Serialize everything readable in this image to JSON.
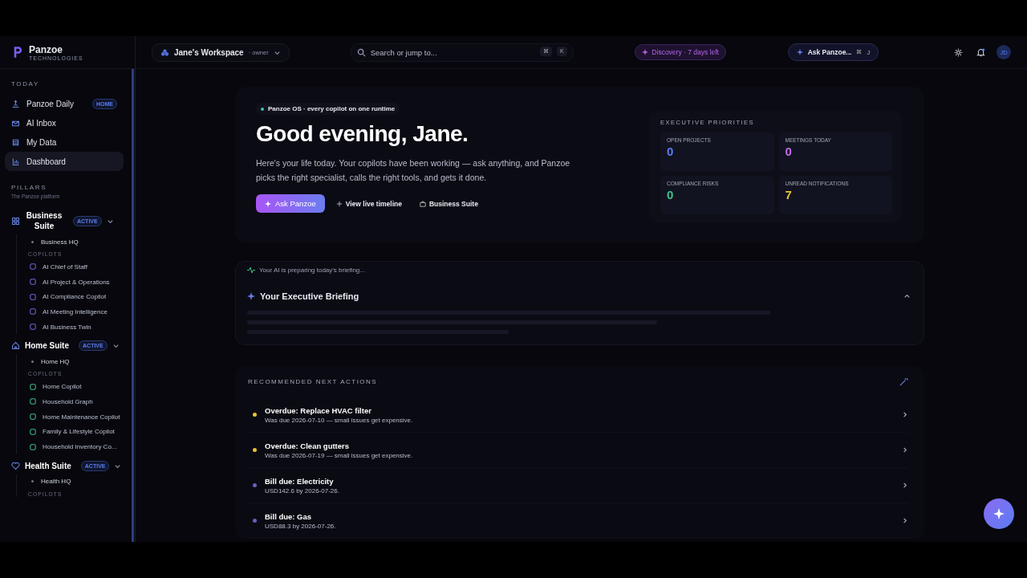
{
  "brand": {
    "name": "Panzoe",
    "tagline": "TECHNOLOGIES"
  },
  "workspace": {
    "name": "Jane's Workspace",
    "role": "· owner"
  },
  "search": {
    "placeholder": "Search or jump to...",
    "keys": [
      "⌘",
      "K"
    ]
  },
  "trial_badge": "Discovery · 7 days left",
  "ask_button": {
    "label": "Ask Panzoe...",
    "keys": [
      "⌘",
      "J"
    ]
  },
  "notifications": {
    "unread": true
  },
  "avatar": "JD",
  "sidebar": {
    "today_heading": "TODAY",
    "today_items": [
      {
        "label": "Panzoe Daily",
        "badge": "HOME",
        "selected": false
      },
      {
        "label": "AI Inbox",
        "selected": false
      },
      {
        "label": "My Data",
        "selected": false
      },
      {
        "label": "Dashboard",
        "selected": true
      }
    ],
    "pillars_heading": "PILLARS",
    "pillars_subtitle": "The Panzoe platform",
    "pillars": [
      {
        "name": "Business Suite",
        "badge": "ACTIVE",
        "expanded": true,
        "hq": "Business HQ",
        "copilots_heading": "COPILOTS",
        "copilots": [
          "AI Chief of Staff",
          "AI Project & Operations",
          "AI Compliance Copilot",
          "AI Meeting Intelligence",
          "AI Business Twin"
        ]
      },
      {
        "name": "Home Suite",
        "badge": "ACTIVE",
        "expanded": true,
        "hq": "Home HQ",
        "copilots_heading": "COPILOTS",
        "copilots": [
          "Home Copilot",
          "Household Graph",
          "Home Maintenance Copilot",
          "Family & Lifestyle Copilot",
          "Household Inventory Co..."
        ]
      },
      {
        "name": "Health Suite",
        "badge": "ACTIVE",
        "expanded": true,
        "hq": "Health HQ",
        "copilots_heading": "COPILOTS"
      }
    ]
  },
  "hero": {
    "chip": "Panzoe OS · every copilot on one runtime",
    "greeting": "Good evening, Jane.",
    "text": "Here's your life today. Your copilots have been working — ask anything, and Panzoe picks the right specialist, calls the right tools, and gets it done.",
    "buttons": [
      {
        "label": "Ask Panzoe",
        "kind": "primary"
      },
      {
        "label": "View live timeline",
        "kind": "timeline"
      },
      {
        "label": "Business Suite",
        "kind": "suite"
      }
    ],
    "priorities": {
      "title": "EXECUTIVE PRIORITIES",
      "stats": [
        {
          "label": "OPEN PROJECTS",
          "value": "0",
          "color": "#5b7cf0"
        },
        {
          "label": "MEETINGS TODAY",
          "value": "0",
          "color": "#c46be8"
        },
        {
          "label": "COMPLIANCE RISKS",
          "value": "0",
          "color": "#3fc28a"
        },
        {
          "label": "UNREAD NOTIFICATIONS",
          "value": "7",
          "color": "#e8c23a"
        }
      ]
    }
  },
  "briefing": {
    "status": "Your AI is preparing today's briefing...",
    "title": "Your Executive Briefing",
    "expanded": true
  },
  "actions": {
    "heading": "RECOMMENDED NEXT ACTIONS",
    "items": [
      {
        "title": "Overdue: Replace HVAC filter",
        "subtitle": "Was due 2026-07-10 — small issues get expensive.",
        "color": "#e8c23a"
      },
      {
        "title": "Overdue: Clean gutters",
        "subtitle": "Was due 2026-07-19 — small issues get expensive.",
        "color": "#e8c23a"
      },
      {
        "title": "Bill due: Electricity",
        "subtitle": "USD142.6 by 2026-07-26.",
        "color": "#6a5fc4"
      },
      {
        "title": "Bill due: Gas",
        "subtitle": "USD88.3 by 2026-07-26.",
        "color": "#6a5fc4"
      }
    ]
  }
}
